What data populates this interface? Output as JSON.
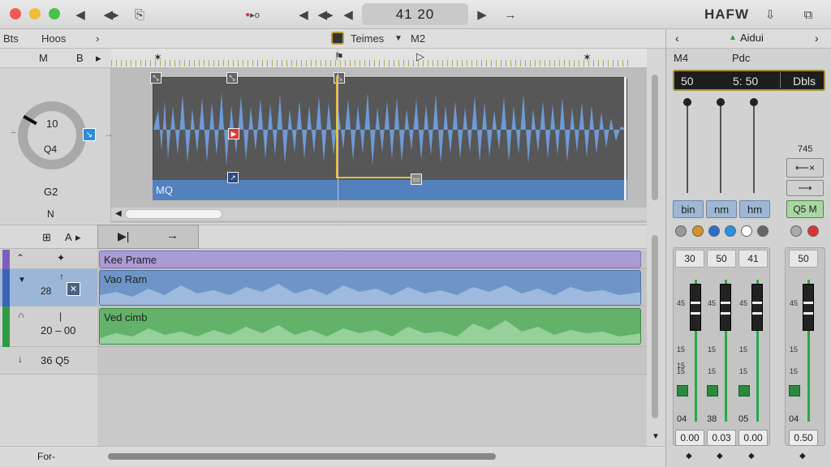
{
  "window": {
    "timecode": "41  20",
    "app_title": "HAFW"
  },
  "toolbar": {
    "left_label": "Bts",
    "hoos_label": "Hoos",
    "center_label": "Teimes",
    "m2_label": "M2"
  },
  "left_panel": {
    "m_label": "M",
    "b_label": "B",
    "knob_value": "10",
    "knob_sub": "Q4",
    "below_knob": "G2",
    "n_label": "N",
    "lower_header_a": "A"
  },
  "waveform": {
    "clip_label": "MQ",
    "accent": "#5b8ccf"
  },
  "tracks": [
    {
      "header_text": "",
      "label": "Kee Prame",
      "color": "#7a5fb8",
      "clip_color": "#a99bd6"
    },
    {
      "header_text": "28",
      "label": "Vao Ram",
      "color": "#3c64b4",
      "clip_color": "#6e95c8"
    },
    {
      "header_text": "20 – 00",
      "label": "Ved cimb",
      "color": "#2e9a45",
      "clip_color": "#62b26a"
    },
    {
      "header_text": "36  Q5",
      "label": "",
      "color": "#d0d0d0",
      "clip_color": ""
    }
  ],
  "bottom": {
    "label": "For-"
  },
  "inspector": {
    "title": "Aidui",
    "m4_label": "M4",
    "pdc_label": "Pdc",
    "lcd_left": "50",
    "lcd_mid": "5: 50",
    "lcd_right": "Dbls",
    "mode_buttons": [
      "bin",
      "nm",
      "hm"
    ],
    "side_value": "745",
    "side_btn": "Q5  M",
    "channels": [
      {
        "label": "30",
        "value_top": "04",
        "value": "0.00"
      },
      {
        "label": "50",
        "value_top": "38",
        "value": "0.03"
      },
      {
        "label": "41",
        "value_top": "05",
        "value": "0.00"
      },
      {
        "label": "50",
        "value_top": "04",
        "value": "0.50"
      }
    ],
    "scale_labels": [
      "45",
      "15",
      "15",
      "15"
    ]
  }
}
